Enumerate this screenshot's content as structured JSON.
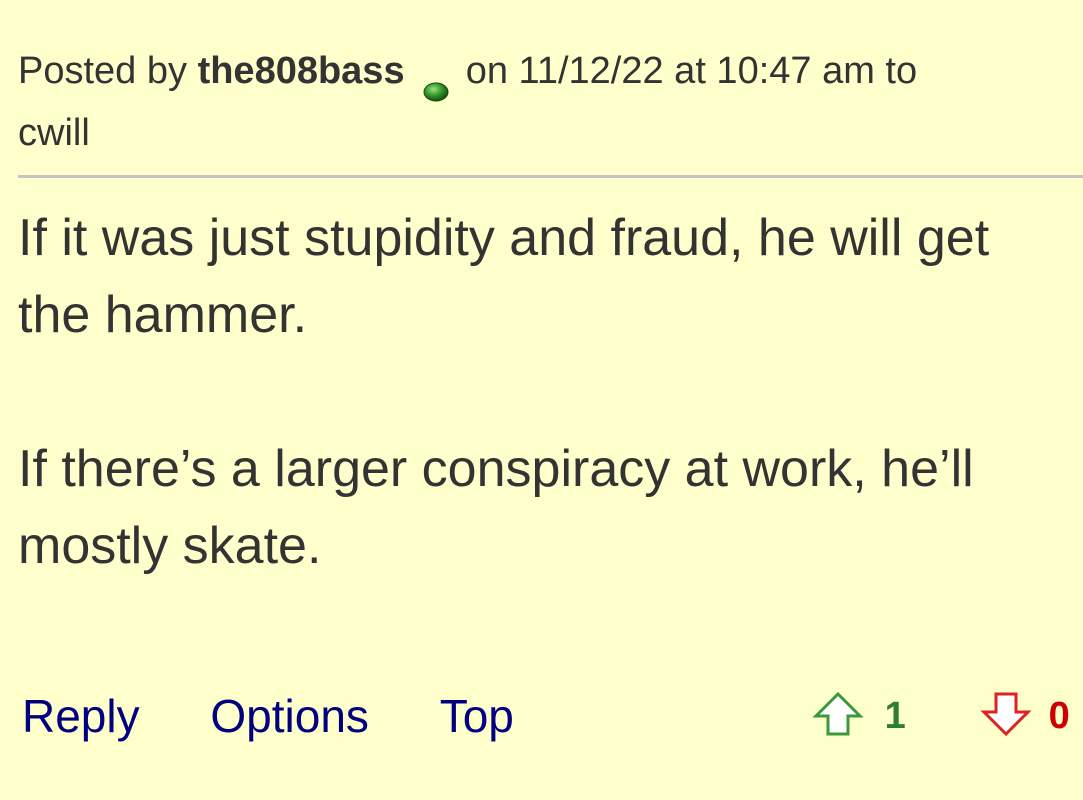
{
  "post": {
    "posted_by_prefix": "Posted by",
    "username": "the808bass",
    "status_icon": "green-dot-icon",
    "posted_on_text": "on 11/12/22 at 10:47 am to",
    "reply_to": "cwill",
    "body_paragraphs": [
      "If it was just stupidity and fraud, he will get the hammer.",
      "If there’s a larger conspiracy at work, he’ll mostly skate."
    ]
  },
  "actions": {
    "reply_label": "Reply",
    "options_label": "Options",
    "top_label": "Top"
  },
  "votes": {
    "upvote_icon": "up-arrow-icon",
    "upvote_count": "1",
    "downvote_icon": "down-arrow-icon",
    "downvote_count": "0"
  },
  "colors": {
    "background": "#ffffcc",
    "text": "#333333",
    "link": "#000080",
    "upvote": "#2e7d32",
    "downvote": "#cc0000",
    "divider": "#c4c4c4"
  }
}
